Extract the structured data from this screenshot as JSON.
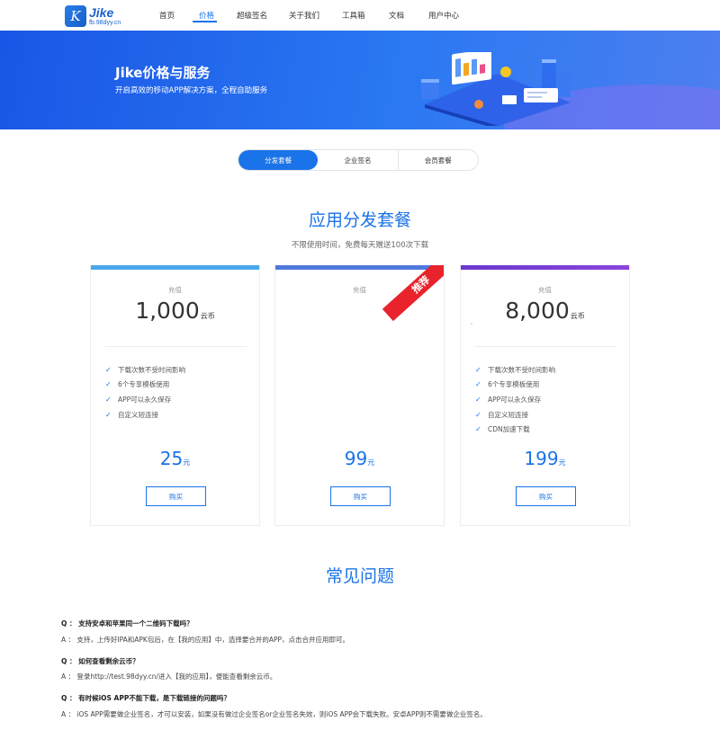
{
  "header": {
    "logo": {
      "name": "Jike",
      "sub": "fb.98dyy.cn",
      "mark": "K"
    },
    "nav": [
      {
        "label": "首页",
        "active": false
      },
      {
        "label": "价格",
        "active": true
      },
      {
        "label": "超级签名",
        "active": false
      },
      {
        "label": "关于我们",
        "active": false
      },
      {
        "label": "工具箱",
        "active": false
      },
      {
        "label": "文档",
        "active": false
      },
      {
        "label": "用户中心",
        "active": false
      }
    ]
  },
  "banner": {
    "title": "Jike价格与服务",
    "subtitle": "开启高效的移动APP解决方案，全程自助服务"
  },
  "tabs": [
    {
      "label": "分发套餐",
      "active": true
    },
    {
      "label": "企业签名",
      "active": false
    },
    {
      "label": "会员套餐",
      "active": false
    }
  ],
  "pricing": {
    "title": "应用分发套餐",
    "subtitle": "不限使用时间，免费每天赠送100次下载",
    "cards": [
      {
        "label": "充值",
        "amount": "1,000",
        "amount_unit": "云币",
        "features": [
          "下载次数不受时间影响",
          "6个专享模板使用",
          "APP可以永久保存",
          "自定义短连接"
        ],
        "price": "25",
        "price_unit": "元",
        "button": "购买",
        "bar_color": "#4aa7ec"
      },
      {
        "label": "充值",
        "amount": "",
        "amount_unit": "",
        "features": [],
        "price": "99",
        "price_unit": "元",
        "button": "购买",
        "bar_color": "#4f79dd",
        "ribbon": "推荐"
      },
      {
        "label": "充值",
        "amount": "8,000",
        "amount_unit": "云币",
        "features": [
          "下载次数不受时间影响",
          "6个专享模板使用",
          "APP可以永久保存",
          "自定义短连接",
          "CDN加速下载"
        ],
        "price": "199",
        "price_unit": "元",
        "button": "购买",
        "bar_color": "#7b3fd6"
      }
    ],
    "stray_mark": "'"
  },
  "faq": {
    "title": "常见问题",
    "items": [
      {
        "q": "Q ：  支持安卓和苹果同一个二维码下载吗？",
        "a": "A ：  支持，上传好IPA和APK包后，在【我的应用】中，选择要合并的APP，点击合并应用即可。"
      },
      {
        "q": "Q ：  如何查看剩余云币？",
        "a": "A ：  登录http://test.98dyy.cn/进入【我的应用】，便能查看剩余云币。"
      },
      {
        "q": "Q ：  有时候iOS APP不能下载，是下载链接的问题吗？",
        "a": "A ：  iOS APP需要做企业签名，才可以安装，如果没有做过企业签名or企业签名失效，则iOS APP会下载失败。安卓APP则不需要做企业签名。"
      }
    ]
  },
  "colors": {
    "accent": "#1a73e8",
    "ribbon": "#e8232c"
  }
}
